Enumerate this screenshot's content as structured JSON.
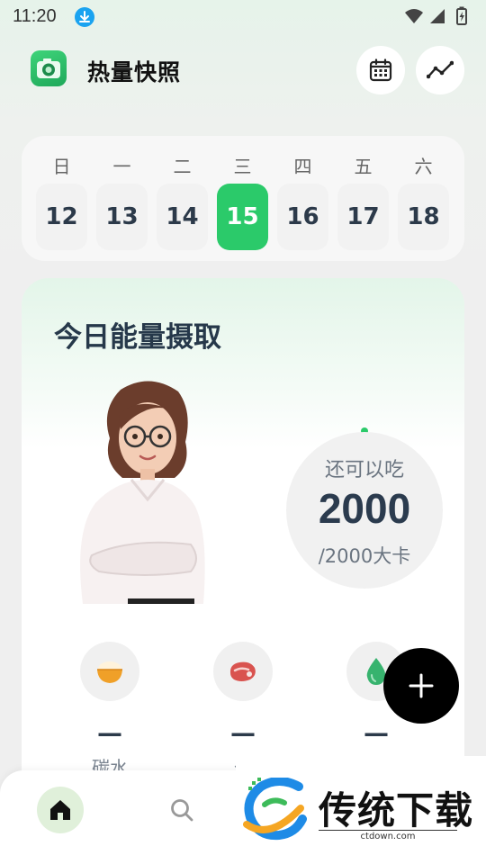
{
  "status_bar": {
    "time": "11:20"
  },
  "header": {
    "title": "热量快照"
  },
  "week": {
    "weekdays": [
      "日",
      "一",
      "二",
      "三",
      "四",
      "五",
      "六"
    ],
    "days": [
      "12",
      "13",
      "14",
      "15",
      "16",
      "17",
      "18"
    ],
    "selected_day": "15"
  },
  "summary": {
    "title": "今日能量摄取",
    "remaining_label": "还可以吃",
    "remaining_value": "2000",
    "total_label": "/2000大卡"
  },
  "nutrients": [
    {
      "label": "碳水",
      "value": "—",
      "icon": "rice-bowl-icon"
    },
    {
      "label": "蛋",
      "value": "—",
      "icon": "meat-icon"
    },
    {
      "label": "",
      "value": "—",
      "icon": "water-drop-icon"
    }
  ],
  "bottom_nav": {
    "items": [
      "home-icon",
      "search-icon"
    ]
  },
  "watermark": {
    "text": "传统下载",
    "url": "ctdown.com"
  },
  "colors": {
    "accent": "#2bca6a",
    "fab": "#000000",
    "text_dark": "#2c3a4a"
  }
}
